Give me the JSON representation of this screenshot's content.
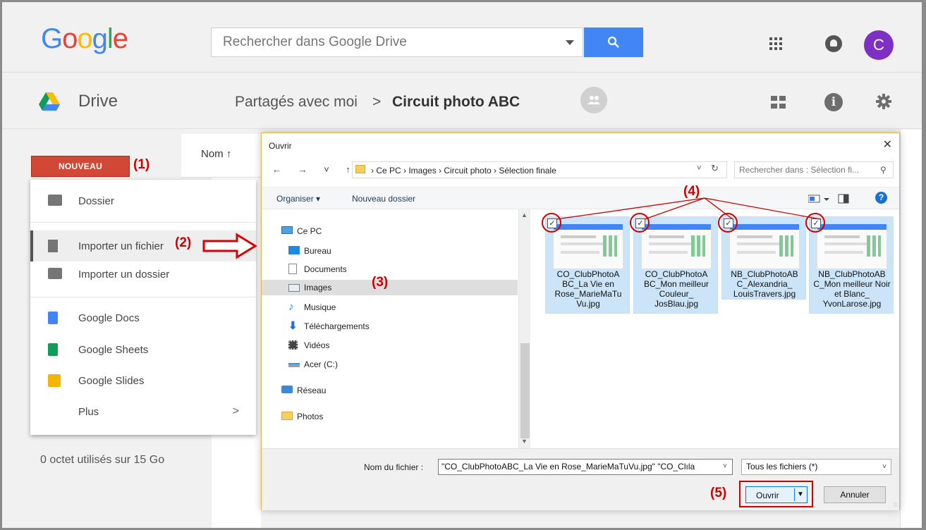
{
  "google": {
    "logo_letters": [
      "G",
      "o",
      "o",
      "g",
      "l",
      "e"
    ],
    "logo_colors": [
      "#4285f4",
      "#ea4335",
      "#fbbc05",
      "#4285f4",
      "#34a853",
      "#ea4335"
    ],
    "search_placeholder": "Rechercher dans Google Drive",
    "avatar_letter": "C",
    "avatar_color": "#7e2fc4"
  },
  "drive": {
    "title": "Drive",
    "breadcrumb": [
      "Partagés avec moi",
      "Circuit photo ABC"
    ],
    "breadcrumb_separator": ">"
  },
  "left": {
    "new_button": "NOUVEAU",
    "new_button_color": "#d14836",
    "storage": "0 octet utilisés sur 15 Go",
    "sort_header": "Nom ↑"
  },
  "menu": {
    "items": [
      {
        "label": "Dossier",
        "icon": "folder-plus-icon"
      },
      {
        "label": "Importer un fichier",
        "icon": "file-upload-icon"
      },
      {
        "label": "Importer un dossier",
        "icon": "folder-upload-icon"
      },
      {
        "label": "Google Docs",
        "icon": "docs-icon",
        "color": "#4285f4"
      },
      {
        "label": "Google Sheets",
        "icon": "sheets-icon",
        "color": "#0f9d58"
      },
      {
        "label": "Google Slides",
        "icon": "slides-icon",
        "color": "#f4b400"
      },
      {
        "label": "Plus",
        "icon": "chevron-right-icon"
      }
    ],
    "plus_arrow": ">"
  },
  "annotations": {
    "a1": "(1)",
    "a2": "(2)",
    "a3": "(3)",
    "a4": "(4)",
    "a5": "(5)"
  },
  "dialog": {
    "title": "Ouvrir",
    "close": "✕",
    "nav_arrows": "← → ˅ ↑",
    "address": "› Ce PC › Images › Circuit photo › Sélection finale",
    "address_caret": "˅",
    "refresh": "↻",
    "search_placeholder": "Rechercher dans : Sélection fi...",
    "search_icon": "⚲",
    "organize": "Organiser ▾",
    "new_folder": "Nouveau dossier",
    "help": "?",
    "tree": [
      {
        "label": "Ce PC",
        "icon": "pc-icon"
      },
      {
        "label": "Bureau",
        "icon": "desktop-icon"
      },
      {
        "label": "Documents",
        "icon": "documents-icon"
      },
      {
        "label": "Images",
        "icon": "images-icon",
        "selected": true
      },
      {
        "label": "Musique",
        "icon": "music-icon"
      },
      {
        "label": "Téléchargements",
        "icon": "download-icon"
      },
      {
        "label": "Vidéos",
        "icon": "video-icon"
      },
      {
        "label": "Acer (C:)",
        "icon": "drive-icon"
      },
      {
        "label": "Réseau",
        "icon": "network-icon"
      },
      {
        "label": "Photos",
        "icon": "photos-icon"
      }
    ],
    "files": [
      {
        "name": "CO_ClubPhotoA BC_La Vie en Rose_MarieMaTu Vu.jpg",
        "checked": true
      },
      {
        "name": "CO_ClubPhotoA BC_Mon meilleur Couleur_ JosBlau.jpg",
        "checked": true
      },
      {
        "name": "NB_ClubPhotoAB C_Alexandria_ LouisTravers.jpg",
        "checked": true
      },
      {
        "name": "NB_ClubPhotoAB C_Mon meilleur Noir et Blanc_ YvonLarose.jpg",
        "checked": true
      }
    ],
    "filename_label": "Nom du fichier :",
    "filename_value": "\"CO_ClubPhotoABC_La Vie en Rose_MarieMaTuVu.jpg\" \"CO_Clıla",
    "filetype": "Tous les fichiers (*)",
    "open_label": "Ouvrir",
    "cancel_label": "Annuler"
  }
}
